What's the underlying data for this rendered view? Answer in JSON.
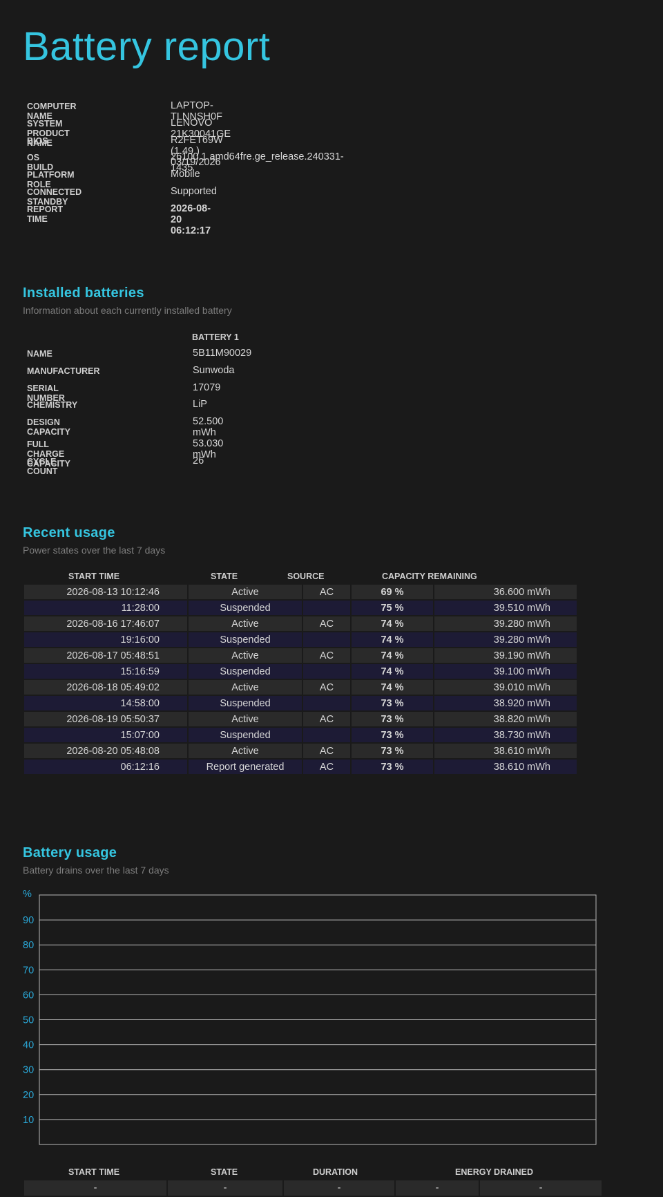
{
  "page_title": "Battery report",
  "system_info": [
    {
      "label": "COMPUTER NAME",
      "value": "LAPTOP-TLNNSH0F"
    },
    {
      "label": "SYSTEM PRODUCT NAME",
      "value": "LENOVO 21K30041GE"
    },
    {
      "label": "BIOS",
      "value": "R2FET69W (1.49 ) 03/19/2026"
    },
    {
      "label": "OS BUILD",
      "value": "26100.1.amd64fre.ge_release.240331-1435"
    },
    {
      "label": "PLATFORM ROLE",
      "value": "Mobile"
    },
    {
      "label": "CONNECTED STANDBY",
      "value": "Supported"
    },
    {
      "label": "REPORT TIME",
      "value": "2026-08-20  06:12:17"
    }
  ],
  "installed": {
    "title": "Installed batteries",
    "subtitle": "Information about each currently installed battery",
    "column": "BATTERY 1",
    "rows": [
      {
        "label": "NAME",
        "value": "5B11M90029"
      },
      {
        "label": "MANUFACTURER",
        "value": "Sunwoda"
      },
      {
        "label": "SERIAL NUMBER",
        "value": "17079"
      },
      {
        "label": "CHEMISTRY",
        "value": "LiP"
      },
      {
        "label": "DESIGN CAPACITY",
        "value": "52.500 mWh"
      },
      {
        "label": "FULL CHARGE CAPACITY",
        "value": "53.030 mWh"
      },
      {
        "label": "CYCLE COUNT",
        "value": "26"
      }
    ]
  },
  "recent": {
    "title": "Recent usage",
    "subtitle": "Power states over the last 7 days",
    "headers": {
      "start": "START TIME",
      "state": "STATE",
      "source": "SOURCE",
      "capacity": "CAPACITY REMAINING"
    },
    "rows": [
      {
        "start": "2026-08-13  10:12:46",
        "state": "Active",
        "source": "AC",
        "pct": "69 %",
        "mwh": "36.600 mWh"
      },
      {
        "start": "11:28:00",
        "state": "Suspended",
        "source": "",
        "pct": "75 %",
        "mwh": "39.510 mWh"
      },
      {
        "start": "2026-08-16  17:46:07",
        "state": "Active",
        "source": "AC",
        "pct": "74 %",
        "mwh": "39.280 mWh"
      },
      {
        "start": "19:16:00",
        "state": "Suspended",
        "source": "",
        "pct": "74 %",
        "mwh": "39.280 mWh"
      },
      {
        "start": "2026-08-17  05:48:51",
        "state": "Active",
        "source": "AC",
        "pct": "74 %",
        "mwh": "39.190 mWh"
      },
      {
        "start": "15:16:59",
        "state": "Suspended",
        "source": "",
        "pct": "74 %",
        "mwh": "39.100 mWh"
      },
      {
        "start": "2026-08-18  05:49:02",
        "state": "Active",
        "source": "AC",
        "pct": "74 %",
        "mwh": "39.010 mWh"
      },
      {
        "start": "14:58:00",
        "state": "Suspended",
        "source": "",
        "pct": "73 %",
        "mwh": "38.920 mWh"
      },
      {
        "start": "2026-08-19  05:50:37",
        "state": "Active",
        "source": "AC",
        "pct": "73 %",
        "mwh": "38.820 mWh"
      },
      {
        "start": "15:07:00",
        "state": "Suspended",
        "source": "",
        "pct": "73 %",
        "mwh": "38.730 mWh"
      },
      {
        "start": "2026-08-20  05:48:08",
        "state": "Active",
        "source": "AC",
        "pct": "73 %",
        "mwh": "38.610 mWh"
      },
      {
        "start": "06:12:16",
        "state": "Report generated",
        "source": "AC",
        "pct": "73 %",
        "mwh": "38.610 mWh"
      }
    ]
  },
  "usage": {
    "title": "Battery usage",
    "subtitle": "Battery drains over the last 7 days",
    "headers": {
      "start": "START TIME",
      "state": "STATE",
      "duration": "DURATION",
      "energy": "ENERGY DRAINED"
    },
    "rows": [
      {
        "start": "-",
        "state": "-",
        "duration": "-",
        "pct": "-",
        "mwh": "-"
      }
    ]
  },
  "chart_data": {
    "type": "line",
    "title": "",
    "ylabel": "%",
    "ylim": [
      0,
      100
    ],
    "yticks": [
      90,
      80,
      70,
      60,
      50,
      40,
      30,
      20,
      10
    ],
    "ytick_labels": [
      "90",
      "80",
      "70",
      "60",
      "50",
      "40",
      "30",
      "20",
      "10"
    ],
    "grid": true,
    "series": [],
    "axis_color": "#2aa8d8",
    "grid_color": "#b8b8b8"
  },
  "colors": {
    "accent": "#35c5e0",
    "row_odd": "#2a2a2a",
    "row_even": "#1d1b35"
  }
}
